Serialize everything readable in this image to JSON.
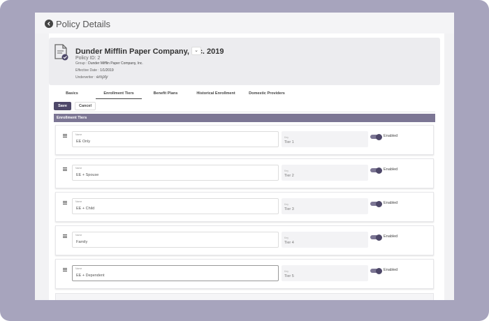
{
  "header": {
    "title": "Policy Details"
  },
  "policy": {
    "company": "Dunder Mifflin Paper Company, Inc. 2019",
    "policy_id": "Policy ID: 2",
    "more_label": "⌄",
    "group_label": "Group :",
    "group_value": "Dunder Mifflin Paper Company, Inc.",
    "effective_label": "Effective Date :",
    "effective_value": "1/1/2019",
    "underwriter_label": "Underwriter :",
    "underwriter_value": "empty"
  },
  "tabs": [
    {
      "label": "Basics"
    },
    {
      "label": "Enrollment Tiers"
    },
    {
      "label": "Benefit Plans"
    },
    {
      "label": "Historical Enrollment"
    },
    {
      "label": "Domestic Providers"
    }
  ],
  "actions": {
    "save": "Save",
    "cancel": "Cancel"
  },
  "section": {
    "title": "Enrollment Tiers"
  },
  "tiers": [
    {
      "name_label": "Name",
      "name": "EE Only",
      "key_label": "Key",
      "key": "Tier 1",
      "status": "Enabled"
    },
    {
      "name_label": "Name",
      "name": "EE + Spouse",
      "key_label": "Key",
      "key": "Tier 2",
      "status": "Enabled"
    },
    {
      "name_label": "Name",
      "name": "EE + Child",
      "key_label": "Key",
      "key": "Tier 3",
      "status": "Enabled"
    },
    {
      "name_label": "Name",
      "name": "Family",
      "key_label": "Key",
      "key": "Tier 4",
      "status": "Enabled"
    },
    {
      "name_label": "Name",
      "name": "EE + Dependent",
      "key_label": "Key",
      "key": "Tier 5",
      "status": "Enabled"
    }
  ],
  "colors": {
    "accent": "#4e4869",
    "section_bg": "#7c7694",
    "frame": "#a7a4bd"
  }
}
